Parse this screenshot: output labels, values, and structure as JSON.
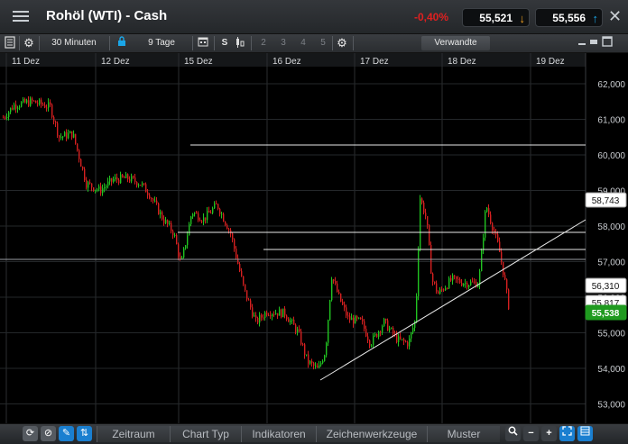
{
  "header": {
    "title": "Rohöl (WTI) - Cash",
    "change": "-0,40%",
    "sell_price": "55,521",
    "buy_price": "55,556",
    "sell_arrow": "↓",
    "buy_arrow": "↑",
    "close_label": "✕",
    "colors": {
      "negative": "#e02020",
      "sell_arrow": "#f0a020",
      "buy_arrow": "#1aa6e8"
    }
  },
  "toolbar": {
    "interval": "30 Minuten",
    "period": "9 Tage",
    "s_label": "S",
    "numbers": [
      "2",
      "3",
      "4",
      "5"
    ],
    "related": "Verwandte"
  },
  "chart": {
    "dates": [
      "11 Dez",
      "12 Dez",
      "15 Dez",
      "16 Dez",
      "17 Dez",
      "18 Dez",
      "19 Dez"
    ],
    "y_ticks": [
      "62,000",
      "61,000",
      "60,000",
      "59,000",
      "58,000",
      "57,000",
      "56,000",
      "55,000",
      "54,000",
      "53,000"
    ],
    "level_labels": {
      "top": "58,743",
      "mid": "56,310",
      "low": "55,817",
      "current": "55,538"
    },
    "colors": {
      "up": "#21c321",
      "down": "#d42020",
      "current_bg": "#1f9a1f"
    }
  },
  "bottombar": {
    "tabs": [
      "Zeitraum",
      "Chart Typ",
      "Indikatoren",
      "Zeichenwerkzeuge",
      "Muster"
    ],
    "zoom_out": "−",
    "zoom_in": "+"
  }
}
